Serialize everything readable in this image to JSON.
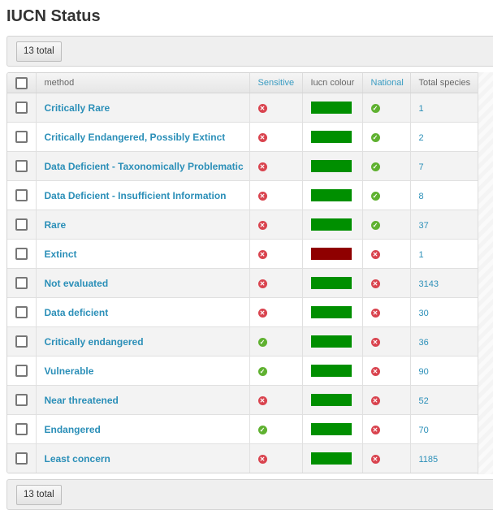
{
  "page": {
    "title": "IUCN Status"
  },
  "toolbar": {
    "total_label": "13 total"
  },
  "footer": {
    "total_label": "13 total"
  },
  "table": {
    "headers": {
      "method": "method",
      "sensitive": "Sensitive",
      "iucn_colour": "Iucn colour",
      "national": "National",
      "total_species": "Total species"
    },
    "rows": [
      {
        "method": "Critically Rare",
        "sensitive": false,
        "colour": "#008f00",
        "national": true,
        "total": "1"
      },
      {
        "method": "Critically Endangered, Possibly Extinct",
        "sensitive": false,
        "colour": "#008f00",
        "national": true,
        "total": "2"
      },
      {
        "method": "Data Deficient - Taxonomically Problematic",
        "sensitive": false,
        "colour": "#008f00",
        "national": true,
        "total": "7"
      },
      {
        "method": "Data Deficient - Insufficient Information",
        "sensitive": false,
        "colour": "#008f00",
        "national": true,
        "total": "8"
      },
      {
        "method": "Rare",
        "sensitive": false,
        "colour": "#008f00",
        "national": true,
        "total": "37"
      },
      {
        "method": "Extinct",
        "sensitive": false,
        "colour": "#8f0000",
        "national": false,
        "total": "1"
      },
      {
        "method": "Not evaluated",
        "sensitive": false,
        "colour": "#008f00",
        "national": false,
        "total": "3143"
      },
      {
        "method": "Data deficient",
        "sensitive": false,
        "colour": "#008f00",
        "national": false,
        "total": "30"
      },
      {
        "method": "Critically endangered",
        "sensitive": true,
        "colour": "#008f00",
        "national": false,
        "total": "36"
      },
      {
        "method": "Vulnerable",
        "sensitive": true,
        "colour": "#008f00",
        "national": false,
        "total": "90"
      },
      {
        "method": "Near threatened",
        "sensitive": false,
        "colour": "#008f00",
        "national": false,
        "total": "52"
      },
      {
        "method": "Endangered",
        "sensitive": true,
        "colour": "#008f00",
        "national": false,
        "total": "70"
      },
      {
        "method": "Least concern",
        "sensitive": false,
        "colour": "#008f00",
        "national": false,
        "total": "1185"
      }
    ]
  },
  "icons": {
    "yes": "check-circle-icon",
    "no": "x-circle-icon"
  }
}
